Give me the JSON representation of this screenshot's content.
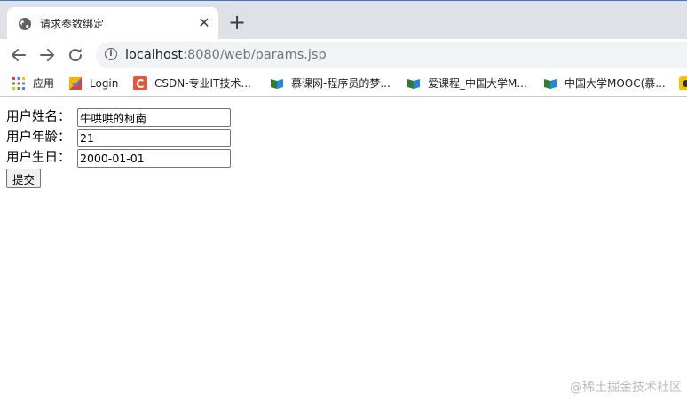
{
  "browser": {
    "tab": {
      "title": "请求参数绑定",
      "close_glyph": "✕"
    },
    "new_tab_glyph": "+",
    "address": {
      "host": "localhost",
      "rest": ":8080/web/params.jsp"
    },
    "bookmarks": [
      {
        "label": "应用",
        "icon": "apps-grid-icon"
      },
      {
        "label": "Login",
        "icon": "login-favicon"
      },
      {
        "label": "CSDN-专业IT技术...",
        "icon": "csdn-favicon"
      },
      {
        "label": "慕课网-程序员的梦...",
        "icon": "imooc-favicon"
      },
      {
        "label": "爱课程_中国大学M...",
        "icon": "icourse-favicon"
      },
      {
        "label": "中国大学MOOC(慕...",
        "icon": "mooc-favicon"
      }
    ],
    "colors": {
      "tabstrip": "#dee1e6",
      "omnibox": "#f1f3f4",
      "accent": "#3c79c9"
    }
  },
  "form": {
    "username": {
      "label": "用户姓名：",
      "value": "牛哄哄的柯南"
    },
    "age": {
      "label": "用户年龄：",
      "value": "21"
    },
    "birthday": {
      "label": "用户生日：",
      "value": "2000-01-01"
    },
    "submit_label": "提交"
  },
  "watermark": "@稀土掘金技术社区"
}
